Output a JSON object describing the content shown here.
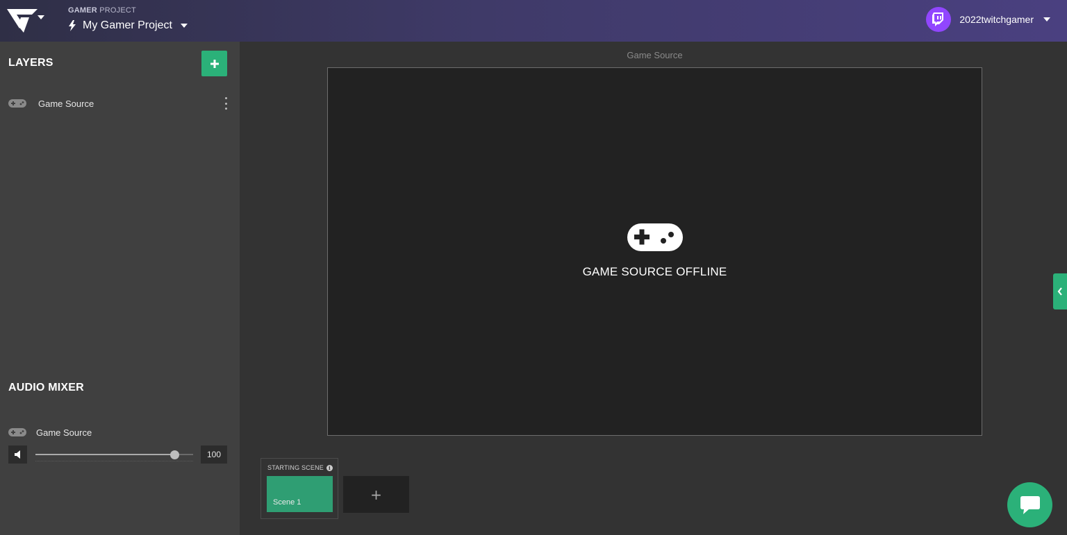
{
  "header": {
    "project_caption_bold": "GAMER",
    "project_caption_rest": " PROJECT",
    "project_name": "My Gamer Project",
    "username": "2022twitchgamer"
  },
  "sidebar": {
    "layers_title": "LAYERS",
    "layers": [
      {
        "label": "Game Source",
        "icon": "gamepad-icon"
      }
    ],
    "audio_mixer_title": "AUDIO MIXER",
    "mixer": [
      {
        "label": "Game Source",
        "volume": "100",
        "level": 0.88
      }
    ]
  },
  "main": {
    "source_caption": "Game Source",
    "offline_text": "GAME SOURCE OFFLINE",
    "scene_group_title": "STARTING SCENE",
    "scenes": [
      {
        "label": "Scene 1"
      }
    ],
    "add_scene_symbol": "+"
  },
  "colors": {
    "accent_green": "#2bb179",
    "twitch_purple": "#9146ff",
    "sidebar_bg": "#404040",
    "main_bg": "#333333",
    "canvas_bg": "#222222"
  }
}
